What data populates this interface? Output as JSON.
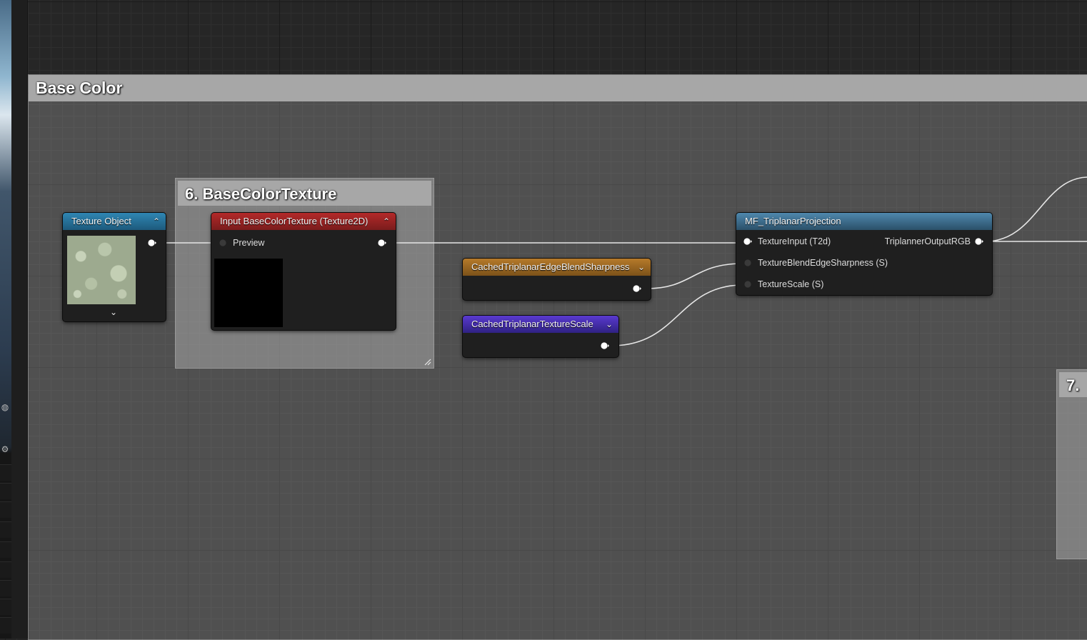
{
  "comments": {
    "base_color": "Base Color",
    "base_color_texture": "6. BaseColorTexture",
    "next_group": "7."
  },
  "nodes": {
    "texture_object": {
      "title": "Texture Object",
      "header_color": "#1d5a7c"
    },
    "input_texture": {
      "title": "Input BaseColorTexture (Texture2D)",
      "preview_label": "Preview",
      "header_color": "#8a1f1f"
    },
    "edge_sharpness": {
      "title": "CachedTriplanarEdgeBlendSharpness",
      "header_color": "#8a5a1c"
    },
    "texture_scale": {
      "title": "CachedTriplanarTextureScale",
      "header_color": "#3a2a8c"
    },
    "triplanar": {
      "title": "MF_TriplanarProjection",
      "header_color": "#37627f",
      "inputs": [
        "TextureInput (T2d)",
        "TextureBlendEdgeSharpness (S)",
        "TextureScale (S)"
      ],
      "output": "TriplannerOutputRGB"
    }
  },
  "icons": [
    "collapse-chevron-icon",
    "expand-chevron-icon",
    "pin-connected-icon",
    "pin-disconnected-icon",
    "gear-icon",
    "resize-grip-icon"
  ],
  "colors": {
    "wire": "#e6e6e6",
    "comment_header": "#a7a7a7",
    "graph_bg": "#262626"
  }
}
